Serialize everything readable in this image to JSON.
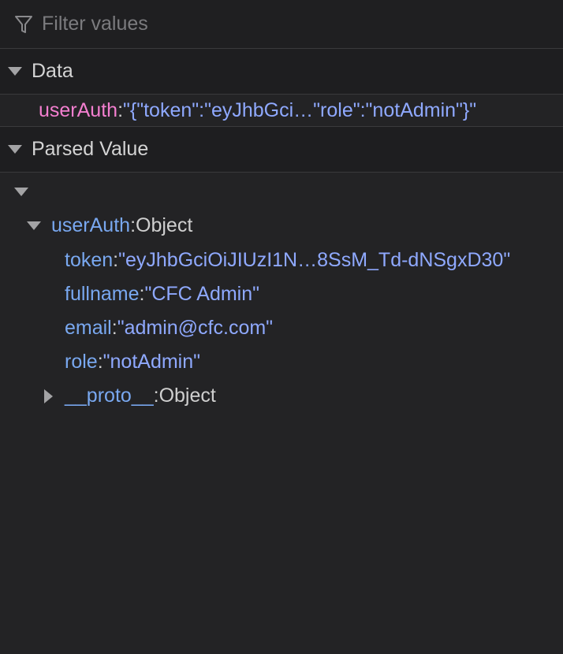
{
  "filter": {
    "placeholder": "Filter values"
  },
  "sections": {
    "data": {
      "title": "Data"
    },
    "parsed": {
      "title": "Parsed Value"
    }
  },
  "data_row": {
    "key": "userAuth",
    "colon": ":",
    "value": "\"{\"token\":\"eyJhbGci…\"role\":\"notAdmin\"}\""
  },
  "tree": {
    "root": {
      "key": "userAuth",
      "colon": ":",
      "type": "Object"
    },
    "props": [
      {
        "key": "token",
        "colon": ":",
        "value": "\"eyJhbGciOiJIUzI1N…8SsM_Td-dNSgxD30\""
      },
      {
        "key": "fullname",
        "colon": ":",
        "value": "\"CFC Admin\""
      },
      {
        "key": "email",
        "colon": ":",
        "value": "\"admin@cfc.com\""
      },
      {
        "key": "role",
        "colon": ":",
        "value": "\"notAdmin\""
      }
    ],
    "proto": {
      "key": "__proto__",
      "colon": ":",
      "type": "Object"
    }
  },
  "colors": {
    "background": "#232325",
    "header_bg": "#1e1e20",
    "pink_key": "#f47fd0",
    "string_value": "#8fa9ff",
    "blue_key": "#79a8f0"
  },
  "icons": {
    "filter": "funnel-icon",
    "expanded": "triangle-down-icon",
    "collapsed": "triangle-right-icon"
  }
}
